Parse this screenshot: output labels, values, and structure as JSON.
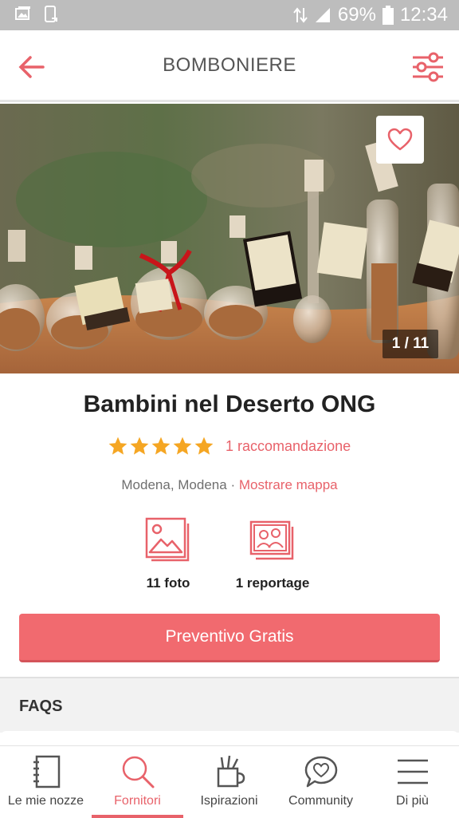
{
  "status_bar": {
    "battery": "69%",
    "time": "12:34",
    "icons": [
      "gallery-icon",
      "phone-icon",
      "data-icon",
      "signal-icon",
      "battery-icon"
    ]
  },
  "header": {
    "title": "BOMBONIERE",
    "back_icon": "arrow-left-icon",
    "filter_icon": "sliders-icon"
  },
  "gallery": {
    "counter": "1 / 11",
    "favorite_icon": "heart-icon"
  },
  "vendor": {
    "name": "Bambini nel Deserto ONG",
    "rating_stars": 5,
    "recommendations": "1 raccomandazione",
    "location": "Modena, Modena",
    "separator": " · ",
    "map_link": "Mostrare mappa"
  },
  "media": {
    "photos": "11 foto",
    "reportage": "1 reportage"
  },
  "cta": {
    "label": "Preventivo Gratis"
  },
  "faqs": {
    "title": "FAQS"
  },
  "tabs": [
    {
      "label": "Le mie nozze",
      "icon": "notebook-icon",
      "active": false
    },
    {
      "label": "Fornitori",
      "icon": "search-icon",
      "active": true
    },
    {
      "label": "Ispirazioni",
      "icon": "pencil-cup-icon",
      "active": false
    },
    {
      "label": "Community",
      "icon": "chat-heart-icon",
      "active": false
    },
    {
      "label": "Di più",
      "icon": "menu-icon",
      "active": false
    }
  ],
  "colors": {
    "accent": "#e8626a",
    "cta": "#f16a6f",
    "star": "#f5a623"
  }
}
